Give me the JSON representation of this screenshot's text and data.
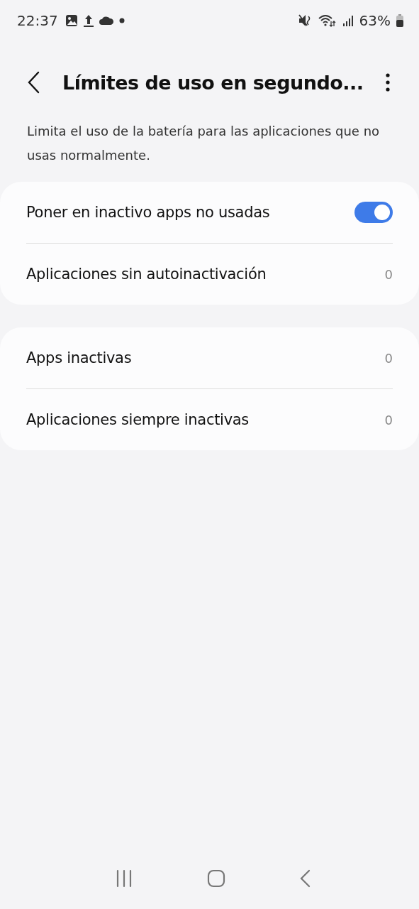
{
  "status_bar": {
    "time": "22:37",
    "battery": "63%"
  },
  "header": {
    "title": "Límites de uso en segundo..."
  },
  "description": "Limita el uso de la batería para las aplicaciones que no usas normalmente.",
  "groups": [
    {
      "rows": [
        {
          "kind": "toggle",
          "label": "Poner en inactivo apps no usadas",
          "on": true
        },
        {
          "kind": "count",
          "label": "Aplicaciones sin autoinactivación",
          "value": "0"
        }
      ]
    },
    {
      "rows": [
        {
          "kind": "count",
          "label": "Apps inactivas",
          "value": "0"
        },
        {
          "kind": "count",
          "label": "Aplicaciones siempre inactivas",
          "value": "0"
        }
      ]
    }
  ]
}
